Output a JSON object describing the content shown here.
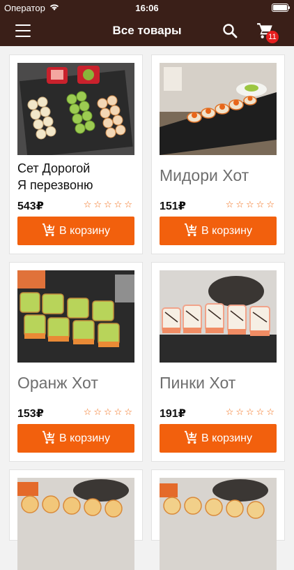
{
  "status_bar": {
    "carrier": "Оператор",
    "time": "16:06"
  },
  "nav": {
    "title": "Все товары",
    "cart_count": "11"
  },
  "products": [
    {
      "name_line1": "Сет Дорогой",
      "name_line2": "Я перезвоню",
      "price": "543₽",
      "stars": "☆☆☆☆☆",
      "button": "В корзину"
    },
    {
      "name": "Мидори Хот",
      "price": "151₽",
      "stars": "☆☆☆☆☆",
      "button": "В корзину"
    },
    {
      "name": "Оранж Хот",
      "price": "153₽",
      "stars": "☆☆☆☆☆",
      "button": "В корзину"
    },
    {
      "name": "Пинки Хот",
      "price": "191₽",
      "stars": "☆☆☆☆☆",
      "button": "В корзину"
    }
  ],
  "colors": {
    "header": "#3a1f18",
    "accent": "#f2600d",
    "badge": "#e61e1e"
  },
  "icons": [
    "menu-icon",
    "search-icon",
    "cart-icon",
    "wifi-icon",
    "battery-icon",
    "cart-plus-icon",
    "star-icon"
  ]
}
